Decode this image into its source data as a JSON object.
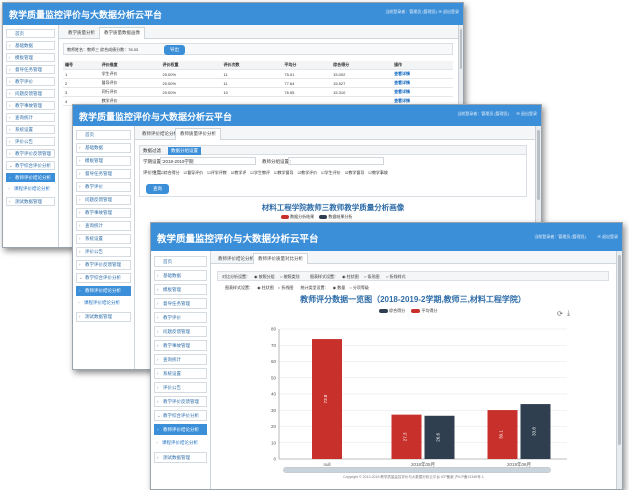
{
  "app_title": "教学质量监控评价与大数据分析云平台",
  "header_info": {
    "welcome": "当前登录者：",
    "user": "管理员 (管理员)",
    "logout": "退出登录"
  },
  "sidebar": {
    "home": "首页",
    "items": [
      "基础数据",
      "模板管理",
      "督导任务管理",
      "教学评价",
      "问题反馈管理",
      "教学事故管理",
      "查询统计",
      "系统设置",
      "评价公告",
      "教学评价反馈管理"
    ],
    "group": "教学综合评价分析",
    "subitems": [
      "教师评价结论分析",
      "课程评价结论分析"
    ],
    "after": [
      "测试数据管理"
    ]
  },
  "win1": {
    "tabs": [
      "教学质量分析",
      "教学质量数据画像"
    ],
    "filter": {
      "label": "教师姓名：教师三 综合成绩分数：78.33",
      "button": "导出"
    },
    "table": {
      "headers": [
        "编号",
        "评价维度",
        "评价权重",
        "评价次数",
        "平均分",
        "综合得分",
        "操作"
      ],
      "rows": [
        [
          "1",
          "学生评价",
          "20.00%",
          "11",
          "75.01",
          "15.002",
          "查看详情"
        ],
        [
          "2",
          "督导评价",
          "20.00%",
          "11",
          "77.64",
          "15.527",
          "查看详情"
        ],
        [
          "3",
          "同行评价",
          "20.00%",
          "10",
          "76.55",
          "15.310",
          "查看详情"
        ],
        [
          "4",
          "教学评价",
          "",
          "",
          "",
          "",
          "查看详情"
        ]
      ]
    }
  },
  "win2": {
    "tabs": [
      "教师评价结论分析",
      "教师质量评价分析"
    ],
    "query_tabs": [
      "数据过滤",
      "数据分组设置"
    ],
    "fields": {
      "period_label": "学期设置：",
      "period_value": "2018-2019学期",
      "teacher_label": "教师分组设置："
    },
    "checks_label": "评价维度：",
    "checks": [
      "综合得分",
      "督导评价",
      "评学评教",
      "教学评",
      "学生教评",
      "教学督导",
      "教学评价",
      "学生评价",
      "教学督导",
      "教学事故"
    ],
    "button": "查询",
    "portrait_title": "材料工程学院教师三教师教学质量分析画像",
    "legend": [
      "数据分析结果",
      "数据结果分析"
    ]
  },
  "win3": {
    "tabs": [
      "教师评价结论分析",
      "教师评价质量对比分析"
    ],
    "compare_label": "对比分析设置：",
    "compare_opts": [
      "按照分组",
      "按照类别"
    ],
    "chart_label": "图表样式设置：",
    "chart_opts": [
      "柱状图",
      "条形图",
      "折线样式"
    ],
    "series_label": "图表样式设置：",
    "series_opts": [
      "柱状图",
      "折线图"
    ],
    "stat_label": "统计类型设置：",
    "stat_opts": [
      "数量",
      "分项等级"
    ],
    "footer": "Copyright © 2013-2018 教学质量监控评价与大数据分析云平台  ICP备案 沪ICP备12345号-1"
  },
  "chart_data": {
    "type": "bar",
    "title": "教师评分数据一览图（2018-2019-2学期,教师三,材料工程学院）",
    "categories": [
      "null",
      "2018年05月",
      "2019年06月"
    ],
    "series": [
      {
        "name": "综合得分",
        "color": "#2f3f4f",
        "values": [
          null,
          26.6,
          33.8
        ]
      },
      {
        "name": "平均得分",
        "color": "#c8302c",
        "values": [
          73.8,
          27.3,
          30.1
        ]
      }
    ],
    "value_labels": [
      {
        "category": 0,
        "series": 1,
        "text": "73.8"
      },
      {
        "category": 1,
        "series": 1,
        "text": "27.3"
      },
      {
        "category": 1,
        "series": 0,
        "text": "26.6"
      },
      {
        "category": 2,
        "series": 1,
        "text": "30.1"
      },
      {
        "category": 2,
        "series": 0,
        "text": "33.8"
      }
    ],
    "ylim": [
      0,
      80
    ],
    "yticks": [
      0,
      10,
      20,
      30,
      40,
      50,
      60,
      70,
      80
    ],
    "grid": true,
    "legend_position": "top"
  },
  "colors": {
    "header": "#3b8ed8",
    "accent": "#3b8ed8",
    "bar_red": "#c8302c",
    "bar_dark": "#2f3f4f"
  }
}
